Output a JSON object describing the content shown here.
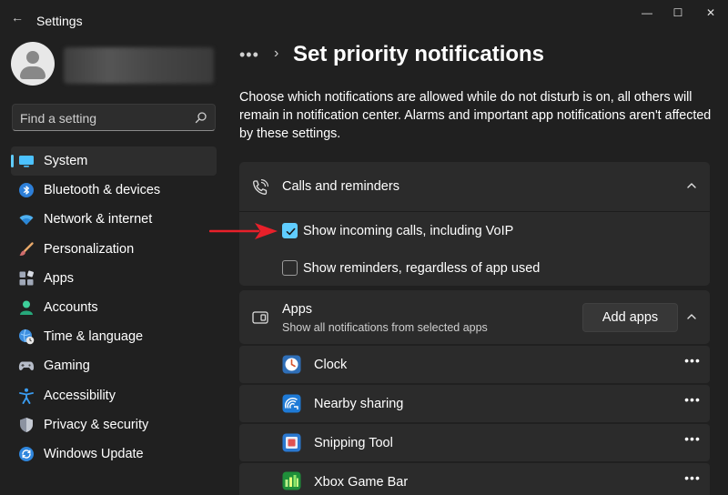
{
  "window": {
    "title": "Settings",
    "back_glyph": "←",
    "min_glyph": "—",
    "max_glyph": "☐",
    "close_glyph": "✕"
  },
  "search": {
    "placeholder": "Find a setting"
  },
  "sidebar": {
    "items": [
      {
        "label": "System",
        "icon": "system-icon",
        "selected": true
      },
      {
        "label": "Bluetooth & devices",
        "icon": "bluetooth-icon"
      },
      {
        "label": "Network & internet",
        "icon": "wifi-icon"
      },
      {
        "label": "Personalization",
        "icon": "brush-icon"
      },
      {
        "label": "Apps",
        "icon": "apps-icon"
      },
      {
        "label": "Accounts",
        "icon": "account-icon"
      },
      {
        "label": "Time & language",
        "icon": "globe-clock-icon"
      },
      {
        "label": "Gaming",
        "icon": "gamepad-icon"
      },
      {
        "label": "Accessibility",
        "icon": "accessibility-icon"
      },
      {
        "label": "Privacy & security",
        "icon": "shield-icon"
      },
      {
        "label": "Windows Update",
        "icon": "update-icon"
      }
    ]
  },
  "breadcrumb": {
    "dots": "•••",
    "chevron": "›",
    "title": "Set priority notifications"
  },
  "description": "Choose which notifications are allowed while do not disturb is on, all others will remain in notification center. Alarms and important app notifications aren't affected by these settings.",
  "calls_card": {
    "title": "Calls and reminders",
    "options": [
      {
        "label": "Show incoming calls, including VoIP",
        "checked": true
      },
      {
        "label": "Show reminders, regardless of app used",
        "checked": false
      }
    ]
  },
  "apps_card": {
    "title": "Apps",
    "subtitle": "Show all notifications from selected apps",
    "add_label": "Add apps"
  },
  "apps": [
    {
      "label": "Clock",
      "icon": "clock-icon"
    },
    {
      "label": "Nearby sharing",
      "icon": "nearby-sharing-icon"
    },
    {
      "label": "Snipping Tool",
      "icon": "snipping-tool-icon"
    },
    {
      "label": "Xbox Game Bar",
      "icon": "xbox-game-bar-icon"
    }
  ],
  "more_glyph": "•••",
  "colors": {
    "accent": "#60cdff",
    "background": "#202020",
    "card": "#2b2b2b",
    "annotation_arrow": "#e8202a"
  }
}
